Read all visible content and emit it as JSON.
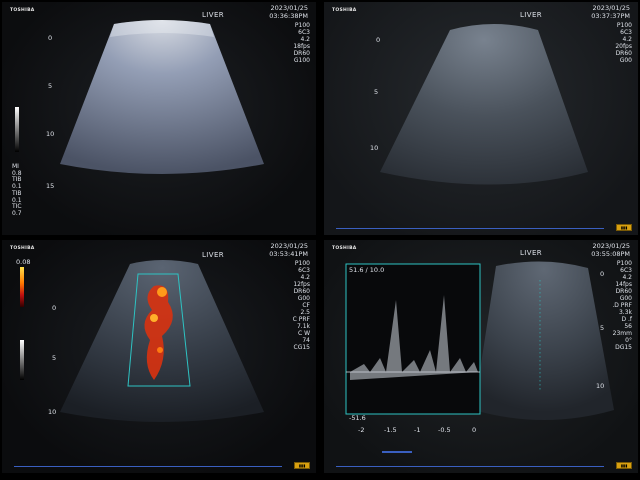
{
  "panels": [
    {
      "brand": "TOSHIBA",
      "organ": "LIVER",
      "date": "2023/01/25",
      "time": "03:36:38PM",
      "params": [
        "P100",
        "6C3",
        "4.2",
        "18fps",
        "DR60",
        "G100"
      ],
      "depth_marks": [
        "0",
        "5",
        "10",
        "15"
      ],
      "left_info": [
        "MI",
        "0.8",
        "TIB",
        "0.1",
        "TIB",
        "0.1",
        "TIC",
        "0.7"
      ]
    },
    {
      "brand": "TOSHIBA",
      "organ": "LIVER",
      "date": "2023/01/25",
      "time": "03:37:37PM",
      "params": [
        "P100",
        "6C3",
        "4.2",
        "20fps",
        "DR60",
        "G00"
      ],
      "depth_marks": [
        "0",
        "5",
        "10"
      ]
    },
    {
      "brand": "TOSHIBA",
      "organ": "LIVER",
      "date": "2023/01/25",
      "time": "03:53:41PM",
      "params": [
        "P100",
        "6C3",
        "4.2",
        "12fps",
        "DR60",
        "G00",
        "CF",
        "2.5",
        "C PRF",
        "7.1k",
        "C W",
        "74",
        "CG15"
      ],
      "depth_marks": [
        "0",
        "5",
        "10"
      ],
      "color_scale_top": "0.08"
    },
    {
      "brand": "TOSHIBA",
      "organ": "LIVER",
      "date": "2023/01/25",
      "time": "03:55:08PM",
      "params": [
        "P100",
        "6C3",
        "4.2",
        "14fps",
        "DR60",
        "G00",
        ".D PRF",
        "3.3k",
        "D .f",
        "56",
        "23mm",
        "0°",
        "DG15"
      ],
      "depth_marks": [
        "0",
        "5",
        "10"
      ],
      "doppler_top": "51.6 / 10.0",
      "doppler_bottom": "-51.6",
      "doppler_axis": [
        "-2",
        "-1.5",
        "-1",
        "-0.5",
        "0"
      ]
    }
  ],
  "colors": {
    "scan_blue": "#aab6cf",
    "color_flow": "#e53a12",
    "doppler_box": "#2ec3c3",
    "battery": "#d8a010"
  }
}
